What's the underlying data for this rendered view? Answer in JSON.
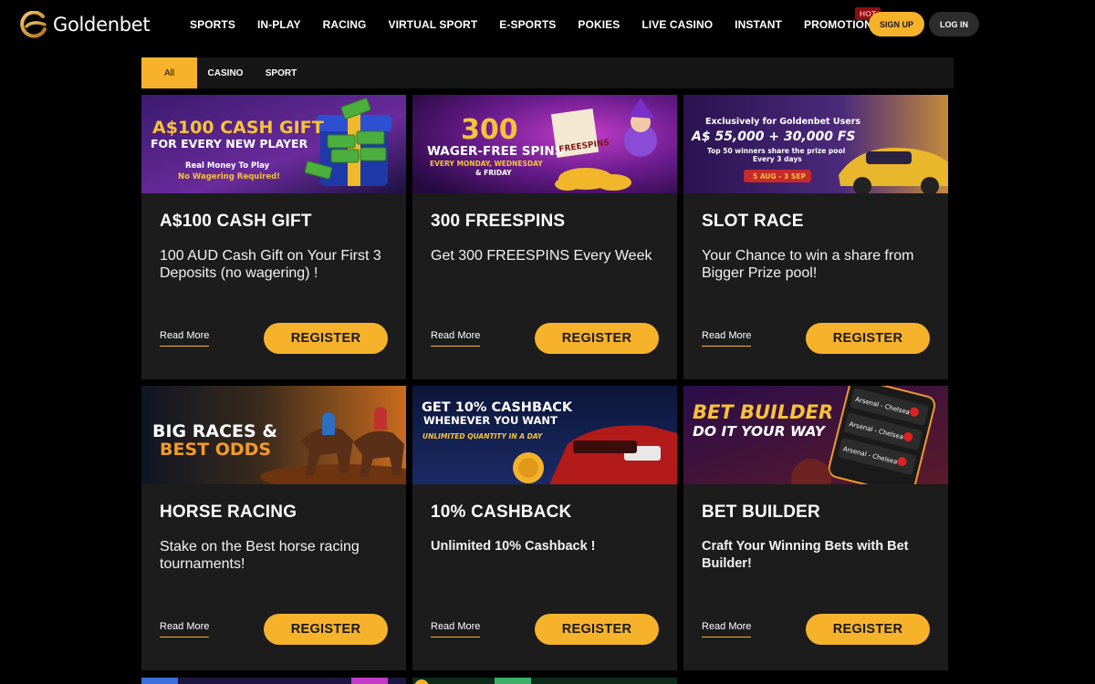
{
  "brand": {
    "name": "Goldenbet"
  },
  "nav": {
    "items": [
      "SPORTS",
      "IN-PLAY",
      "RACING",
      "VIRTUAL SPORT",
      "E-SPORTS",
      "POKIES",
      "LIVE CASINO",
      "INSTANT",
      "PROMOTIONS"
    ],
    "hot_badge": "HOT"
  },
  "auth": {
    "signup": "SIGN UP",
    "login": "LOG IN"
  },
  "filters": {
    "tabs": [
      "All",
      "CASINO",
      "SPORT"
    ],
    "active": "All"
  },
  "promos": [
    {
      "banner": {
        "line1": "A$100 CASH GIFT",
        "line2": "FOR EVERY NEW PLAYER",
        "line3": "Real Money To Play",
        "line4": "No Wagering Required!"
      },
      "title": "A$100 CASH GIFT",
      "desc": "100 AUD Cash Gift on Your First 3 Deposits (no wagering) !",
      "read_more": "Read More",
      "register": "REGISTER"
    },
    {
      "banner": {
        "line1": "300",
        "line2": "WAGER-FREE SPINS",
        "line3": "EVERY MONDAY, WEDNESDAY",
        "line4": "& FRIDAY",
        "flag": "FREESPINS"
      },
      "title": "300 FREESPINS",
      "desc": "Get 300 FREESPINS Every Week",
      "read_more": "Read More",
      "register": "REGISTER"
    },
    {
      "banner": {
        "line1": "Exclusively for Goldenbet Users",
        "line2": "A$ 55,000 + 30,000 FS",
        "line3": "Top 50 winners share the prize pool",
        "line4": "Every 3 days",
        "dates": "5 AUG - 3 SEP"
      },
      "title": "SLOT RACE",
      "desc": "Your Chance to win a share from Bigger Prize pool!",
      "read_more": "Read More",
      "register": "REGISTER"
    },
    {
      "banner": {
        "line1": "BIG RACES &",
        "line2": "BEST ODDS"
      },
      "title": "HORSE RACING",
      "desc": "Stake on the Best horse racing tournaments!",
      "read_more": "Read More",
      "register": "REGISTER"
    },
    {
      "banner": {
        "line1": "GET 10% CASHBACK",
        "line2": "WHENEVER YOU WANT",
        "line3": "UNLIMITED QUANTITY IN A DAY"
      },
      "title": "10% CASHBACK",
      "desc": "Unlimited 10% Cashback !",
      "read_more": "Read More",
      "register": "REGISTER"
    },
    {
      "banner": {
        "line1": "BET BUILDER",
        "line2": "DO IT YOUR WAY",
        "match": "Arsenal - Chelsea"
      },
      "title": "BET BUILDER",
      "desc": "Craft Your Winning Bets with Bet Builder!",
      "read_more": "Read More",
      "register": "REGISTER"
    }
  ],
  "colors": {
    "accent": "#f7b22c",
    "card_bg": "#1c1c1c",
    "page_bg": "#000000",
    "hot": "#8a1010"
  }
}
